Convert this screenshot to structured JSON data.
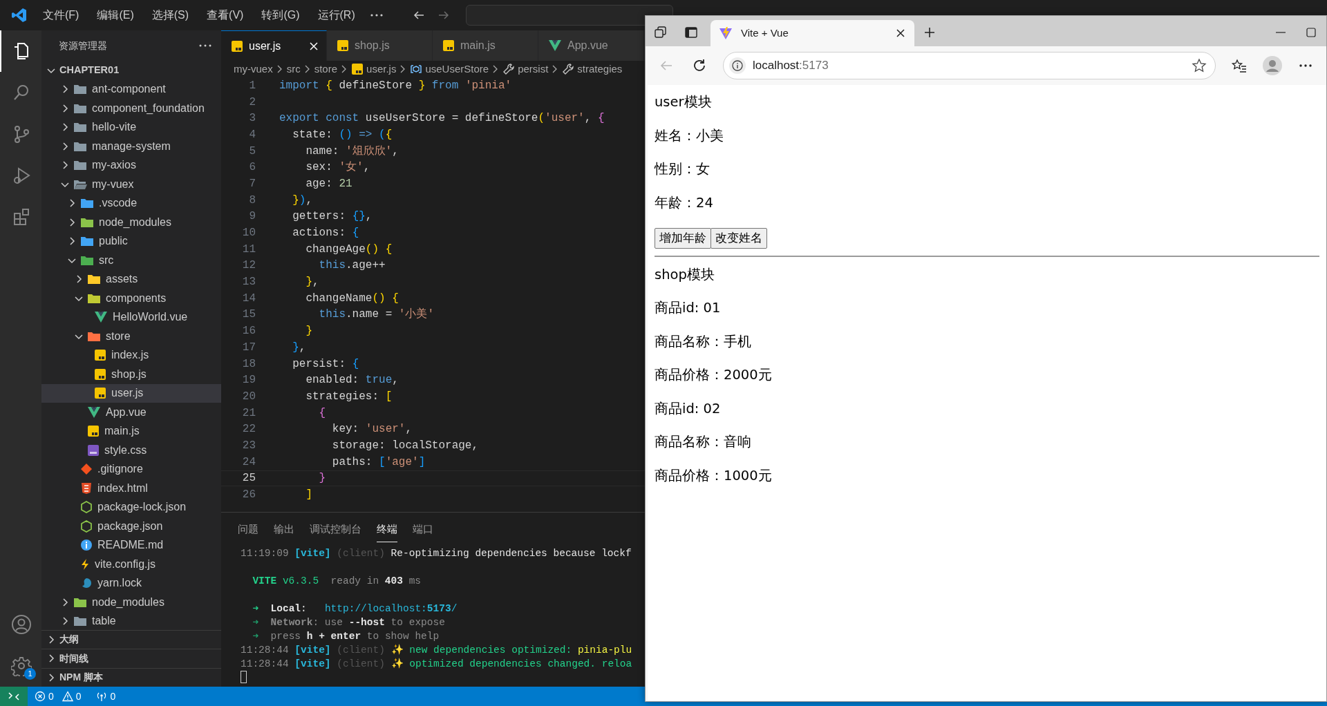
{
  "menu": [
    "文件(F)",
    "编辑(E)",
    "选择(S)",
    "查看(V)",
    "转到(G)",
    "运行(R)"
  ],
  "activity_bar": {
    "items": [
      {
        "kind": "files",
        "selected": true
      },
      {
        "kind": "search",
        "selected": false
      },
      {
        "kind": "source-control",
        "selected": false
      },
      {
        "kind": "debug",
        "selected": false
      },
      {
        "kind": "extensions",
        "selected": false
      }
    ],
    "settings_badge": "1"
  },
  "explorer": {
    "title": "资源管理器",
    "root": {
      "name": "CHAPTER01",
      "expanded": true
    },
    "tree": [
      {
        "name": "ant-component",
        "kind": "folder",
        "expanded": false,
        "selected": false
      },
      {
        "name": "component_foundation",
        "kind": "folder",
        "expanded": false,
        "selected": false
      },
      {
        "name": "hello-vite",
        "kind": "folder",
        "expanded": false,
        "selected": false
      },
      {
        "name": "manage-system",
        "kind": "folder",
        "expanded": false,
        "selected": false
      },
      {
        "name": "my-axios",
        "kind": "folder",
        "expanded": false,
        "selected": false
      },
      {
        "name": "my-vuex",
        "kind": "folder",
        "expanded": true,
        "selected": false,
        "children": [
          {
            "name": ".vscode",
            "kind": "folder-vscode",
            "expanded": false,
            "selected": false
          },
          {
            "name": "node_modules",
            "kind": "folder-node",
            "expanded": false,
            "selected": false
          },
          {
            "name": "public",
            "kind": "folder-public",
            "expanded": false,
            "selected": false
          },
          {
            "name": "src",
            "kind": "folder-src",
            "expanded": true,
            "selected": false,
            "children": [
              {
                "name": "assets",
                "kind": "folder-assets",
                "expanded": false,
                "selected": false
              },
              {
                "name": "components",
                "kind": "folder-components",
                "expanded": true,
                "selected": false,
                "children": [
                  {
                    "name": "HelloWorld.vue",
                    "kind": "vue",
                    "selected": false
                  }
                ]
              },
              {
                "name": "store",
                "kind": "folder-store",
                "expanded": true,
                "selected": false,
                "children": [
                  {
                    "name": "index.js",
                    "kind": "js",
                    "selected": false
                  },
                  {
                    "name": "shop.js",
                    "kind": "js",
                    "selected": false
                  },
                  {
                    "name": "user.js",
                    "kind": "js",
                    "selected": true
                  }
                ]
              },
              {
                "name": "App.vue",
                "kind": "vue",
                "selected": false
              },
              {
                "name": "main.js",
                "kind": "js",
                "selected": false
              },
              {
                "name": "style.css",
                "kind": "css",
                "selected": false
              }
            ]
          },
          {
            "name": ".gitignore",
            "kind": "git",
            "selected": false
          },
          {
            "name": "index.html",
            "kind": "html",
            "selected": false
          },
          {
            "name": "package-lock.json",
            "kind": "json",
            "selected": false
          },
          {
            "name": "package.json",
            "kind": "json",
            "selected": false
          },
          {
            "name": "README.md",
            "kind": "info",
            "selected": false
          },
          {
            "name": "vite.config.js",
            "kind": "vite",
            "selected": false
          },
          {
            "name": "yarn.lock",
            "kind": "yarn",
            "selected": false
          }
        ]
      },
      {
        "name": "node_modules",
        "kind": "folder-node",
        "expanded": false,
        "selected": false
      },
      {
        "name": "table",
        "kind": "folder",
        "expanded": false,
        "selected": false
      }
    ],
    "sections": [
      {
        "label": "大纲",
        "expanded": false
      },
      {
        "label": "时间线",
        "expanded": false
      },
      {
        "label": "NPM 脚本",
        "expanded": false
      }
    ]
  },
  "editor": {
    "tabs": [
      {
        "label": "user.js",
        "kind": "js",
        "selected": true
      },
      {
        "label": "shop.js",
        "kind": "js",
        "selected": false
      },
      {
        "label": "main.js",
        "kind": "js",
        "selected": false
      },
      {
        "label": "App.vue",
        "kind": "vue",
        "selected": false
      }
    ],
    "breadcrumb": [
      {
        "text": "my-vuex",
        "kind": "folder"
      },
      {
        "text": "src",
        "kind": "folder"
      },
      {
        "text": "store",
        "kind": "folder"
      },
      {
        "text": "user.js",
        "kind": "js"
      },
      {
        "text": "useUserStore",
        "kind": "symbol"
      },
      {
        "text": "persist",
        "kind": "property"
      },
      {
        "text": "strategies",
        "kind": "property"
      }
    ],
    "lines": [
      {
        "n": "1",
        "current": false,
        "tokens": [
          {
            "t": "import ",
            "kind": "keyword"
          },
          {
            "t": "{",
            "kind": "gold"
          },
          {
            "t": " defineStore ",
            "kind": "plain"
          },
          {
            "t": "}",
            "kind": "gold"
          },
          {
            "t": " from ",
            "kind": "keyword"
          },
          {
            "t": "'pinia'",
            "kind": "string"
          }
        ]
      },
      {
        "n": "2",
        "current": false
      },
      {
        "n": "3",
        "current": false,
        "tokens": [
          {
            "t": "export const",
            "kind": "keyword"
          },
          {
            "t": " useUserStore = defineStore",
            "kind": "plain"
          },
          {
            "t": "(",
            "kind": "gold"
          },
          {
            "t": "'user'",
            "kind": "string"
          },
          {
            "t": ", ",
            "kind": "plain"
          },
          {
            "t": "{",
            "kind": "pink"
          }
        ]
      },
      {
        "n": "4",
        "current": false,
        "tokens": [
          {
            "t": "  state: ",
            "kind": "plain"
          },
          {
            "t": "()",
            "kind": "blue"
          },
          {
            "t": " => ",
            "kind": "keyword"
          },
          {
            "t": "(",
            "kind": "blue"
          },
          {
            "t": "{",
            "kind": "gold"
          }
        ]
      },
      {
        "n": "5",
        "current": false,
        "tokens": [
          {
            "t": "    name: ",
            "kind": "plain"
          },
          {
            "t": "'俎欣欣'",
            "kind": "string"
          },
          {
            "t": ",",
            "kind": "plain"
          }
        ]
      },
      {
        "n": "6",
        "current": false,
        "tokens": [
          {
            "t": "    sex: ",
            "kind": "plain"
          },
          {
            "t": "'女'",
            "kind": "string"
          },
          {
            "t": ",",
            "kind": "plain"
          }
        ]
      },
      {
        "n": "7",
        "current": false,
        "tokens": [
          {
            "t": "    age: ",
            "kind": "plain"
          },
          {
            "t": "21",
            "kind": "number"
          }
        ]
      },
      {
        "n": "8",
        "current": false,
        "tokens": [
          {
            "t": "  }",
            "kind": "gold"
          },
          {
            "t": ")",
            "kind": "blue"
          },
          {
            "t": ",",
            "kind": "plain"
          }
        ]
      },
      {
        "n": "9",
        "current": false,
        "tokens": [
          {
            "t": "  getters: ",
            "kind": "plain"
          },
          {
            "t": "{}",
            "kind": "blue"
          },
          {
            "t": ",",
            "kind": "plain"
          }
        ]
      },
      {
        "n": "10",
        "current": false,
        "tokens": [
          {
            "t": "  actions: ",
            "kind": "plain"
          },
          {
            "t": "{",
            "kind": "blue"
          }
        ]
      },
      {
        "n": "11",
        "current": false,
        "tokens": [
          {
            "t": "    changeAge",
            "kind": "plain"
          },
          {
            "t": "() {",
            "kind": "gold"
          }
        ]
      },
      {
        "n": "12",
        "current": false,
        "tokens": [
          {
            "t": "      this",
            "kind": "keyword"
          },
          {
            "t": ".age++",
            "kind": "plain"
          }
        ]
      },
      {
        "n": "13",
        "current": false,
        "tokens": [
          {
            "t": "    }",
            "kind": "gold"
          },
          {
            "t": ",",
            "kind": "plain"
          }
        ]
      },
      {
        "n": "14",
        "current": false,
        "tokens": [
          {
            "t": "    changeName",
            "kind": "plain"
          },
          {
            "t": "() {",
            "kind": "gold"
          }
        ]
      },
      {
        "n": "15",
        "current": false,
        "tokens": [
          {
            "t": "      this",
            "kind": "keyword"
          },
          {
            "t": ".name = ",
            "kind": "plain"
          },
          {
            "t": "'小美'",
            "kind": "string"
          }
        ]
      },
      {
        "n": "16",
        "current": false,
        "tokens": [
          {
            "t": "    }",
            "kind": "gold"
          }
        ]
      },
      {
        "n": "17",
        "current": false,
        "tokens": [
          {
            "t": "  }",
            "kind": "blue"
          },
          {
            "t": ",",
            "kind": "plain"
          }
        ]
      },
      {
        "n": "18",
        "current": false,
        "tokens": [
          {
            "t": "  persist: ",
            "kind": "plain"
          },
          {
            "t": "{",
            "kind": "blue"
          }
        ]
      },
      {
        "n": "19",
        "current": false,
        "tokens": [
          {
            "t": "    enabled: ",
            "kind": "plain"
          },
          {
            "t": "true",
            "kind": "keyword"
          },
          {
            "t": ",",
            "kind": "plain"
          }
        ]
      },
      {
        "n": "20",
        "current": false,
        "tokens": [
          {
            "t": "    strategies: ",
            "kind": "plain"
          },
          {
            "t": "[",
            "kind": "gold"
          }
        ]
      },
      {
        "n": "21",
        "current": false,
        "tokens": [
          {
            "t": "      {",
            "kind": "pink"
          }
        ]
      },
      {
        "n": "22",
        "current": false,
        "tokens": [
          {
            "t": "        key: ",
            "kind": "plain"
          },
          {
            "t": "'user'",
            "kind": "string"
          },
          {
            "t": ",",
            "kind": "plain"
          }
        ]
      },
      {
        "n": "23",
        "current": false,
        "tokens": [
          {
            "t": "        storage: localStorage,",
            "kind": "plain"
          }
        ]
      },
      {
        "n": "24",
        "current": false,
        "tokens": [
          {
            "t": "        paths: ",
            "kind": "plain"
          },
          {
            "t": "[",
            "kind": "blue"
          },
          {
            "t": "'age'",
            "kind": "string"
          },
          {
            "t": "]",
            "kind": "blue"
          }
        ]
      },
      {
        "n": "25",
        "current": true,
        "tokens": [
          {
            "t": "      }",
            "kind": "pink"
          }
        ]
      },
      {
        "n": "26",
        "current": false,
        "tokens": [
          {
            "t": "    ]",
            "kind": "gold"
          }
        ]
      }
    ]
  },
  "panel": {
    "tabs": [
      {
        "label": "问题",
        "selected": false
      },
      {
        "label": "输出",
        "selected": false
      },
      {
        "label": "调试控制台",
        "selected": false
      },
      {
        "label": "终端",
        "selected": true
      },
      {
        "label": "端口",
        "selected": false
      }
    ],
    "blocks": [
      [
        [
          {
            "t": "11:19:09 ",
            "kind": "time"
          },
          {
            "t": "[vite]",
            "kind": "tag"
          },
          {
            "t": " (client)",
            "kind": "dim"
          },
          {
            "t": " Re-optimizing dependencies because lockf",
            "kind": "text"
          }
        ]
      ],
      [
        [
          {
            "t": "  VITE",
            "kind": "greenb"
          },
          {
            "t": " v6.3.5",
            "kind": "green"
          },
          {
            "t": "  ready in ",
            "kind": "grey"
          },
          {
            "t": "403",
            "kind": "whiteb"
          },
          {
            "t": " ms",
            "kind": "grey"
          }
        ]
      ],
      [
        [
          {
            "t": "  ➜",
            "kind": "green"
          },
          {
            "t": "  Local",
            "kind": "whiteb"
          },
          {
            "t": ":   ",
            "kind": "text"
          },
          {
            "t": "http://localhost:",
            "kind": "cyan"
          },
          {
            "t": "5173",
            "kind": "cyanb"
          },
          {
            "t": "/",
            "kind": "cyan"
          }
        ],
        [
          {
            "t": "  ➜",
            "kind": "dgreen"
          },
          {
            "t": "  Network",
            "kind": "greyb"
          },
          {
            "t": ": use ",
            "kind": "grey"
          },
          {
            "t": "--host",
            "kind": "whiteb"
          },
          {
            "t": " to expose",
            "kind": "grey"
          }
        ],
        [
          {
            "t": "  ➜",
            "kind": "dgreen"
          },
          {
            "t": "  press ",
            "kind": "grey"
          },
          {
            "t": "h + enter",
            "kind": "whiteb"
          },
          {
            "t": " to show help",
            "kind": "grey"
          }
        ],
        [
          {
            "t": "11:28:44 ",
            "kind": "time"
          },
          {
            "t": "[vite]",
            "kind": "tag"
          },
          {
            "t": " (client) ",
            "kind": "dim"
          },
          {
            "t": "✨",
            "kind": "yellow"
          },
          {
            "t": " new dependencies optimized: ",
            "kind": "green"
          },
          {
            "t": "pinia-plu",
            "kind": "yellow"
          }
        ],
        [
          {
            "t": "11:28:44 ",
            "kind": "time"
          },
          {
            "t": "[vite]",
            "kind": "tag"
          },
          {
            "t": " (client) ",
            "kind": "dim"
          },
          {
            "t": "✨",
            "kind": "yellow"
          },
          {
            "t": " optimized dependencies changed. reloa",
            "kind": "green"
          }
        ]
      ]
    ]
  },
  "status_bar": {
    "errors": "0",
    "warnings": "0",
    "ports": "0"
  },
  "browser": {
    "tabs": [
      {
        "title": "Vite + Vue",
        "selected": true
      }
    ],
    "url": {
      "host": "localhost",
      "port": ":5173"
    },
    "page": {
      "user": {
        "title": "user模块",
        "fields": [
          "姓名：小美",
          "性别：女",
          "年龄：24"
        ],
        "buttons": [
          "增加年龄",
          "改变姓名"
        ]
      },
      "shop": {
        "title": "shop模块",
        "products": [
          {
            "id": "商品id: 01",
            "name": "商品名称：手机",
            "price": "商品价格：2000元"
          },
          {
            "id": "商品id: 02",
            "name": "商品名称：音响",
            "price": "商品价格：1000元"
          }
        ]
      }
    }
  }
}
